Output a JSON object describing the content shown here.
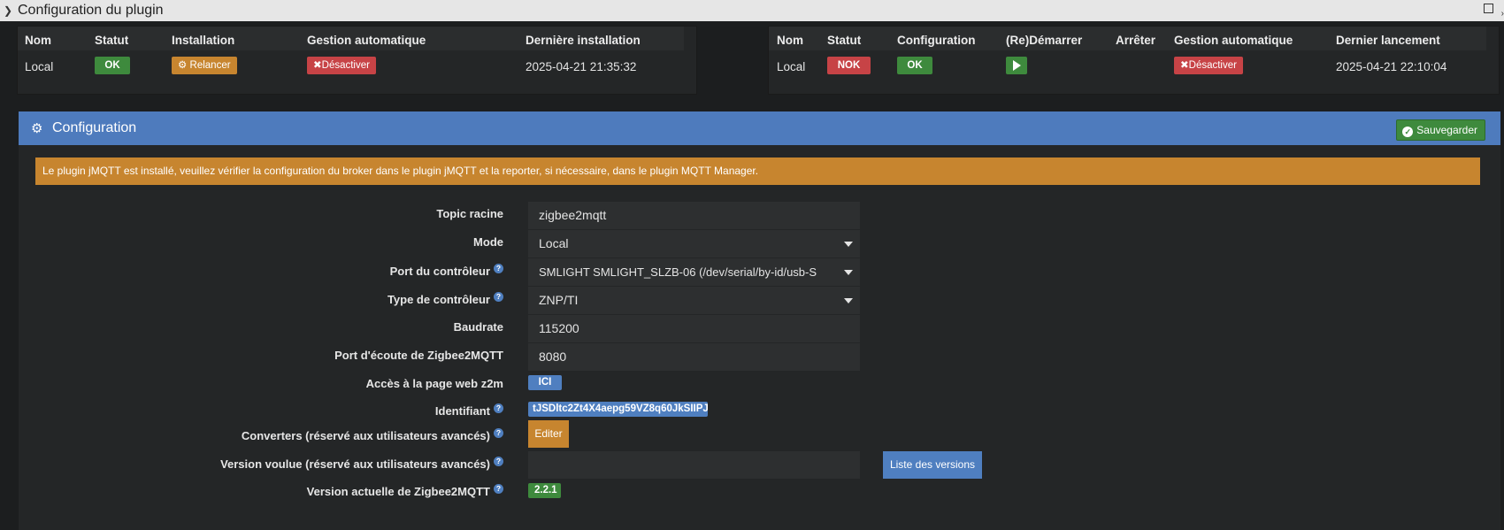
{
  "window": {
    "title": "Configuration du plugin"
  },
  "dependencies": {
    "headers": [
      "Nom",
      "Statut",
      "Installation",
      "Gestion automatique",
      "Dernière installation"
    ],
    "row": {
      "name": "Local",
      "status": "OK",
      "install_button": "Relancer",
      "auto_button": "Désactiver",
      "last_install": "2025-04-21 21:35:32"
    }
  },
  "daemon": {
    "headers": [
      "Nom",
      "Statut",
      "Configuration",
      "(Re)Démarrer",
      "Arrêter",
      "Gestion automatique",
      "Dernier lancement"
    ],
    "row": {
      "name": "Local",
      "status": "NOK",
      "config": "OK",
      "auto_button": "Désactiver",
      "last_launch": "2025-04-21 22:10:04"
    }
  },
  "config": {
    "title": "Configuration",
    "save_label": "Sauvegarder",
    "warning": "Le plugin jMQTT est installé, veuillez vérifier la configuration du broker dans le plugin jMQTT et la reporter, si nécessaire, dans le plugin MQTT Manager.",
    "fields": {
      "topic": {
        "label": "Topic racine",
        "value": "zigbee2mqtt"
      },
      "mode": {
        "label": "Mode",
        "value": "Local"
      },
      "port": {
        "label": "Port du contrôleur",
        "value": "SMLIGHT SMLIGHT_SLZB-06 (/dev/serial/by-id/usb-S"
      },
      "type": {
        "label": "Type de contrôleur",
        "value": "ZNP/TI"
      },
      "baudrate": {
        "label": "Baudrate",
        "value": "115200"
      },
      "listen_port": {
        "label": "Port d'écoute de Zigbee2MQTT",
        "value": "8080"
      },
      "web": {
        "label": "Accès à la page web z2m",
        "value": "ICI"
      },
      "identifier": {
        "label": "Identifiant",
        "value": "tJSDltc2Zt4X4aepg59VZ8q60JkSIIPJ"
      },
      "converters": {
        "label": "Converters (réservé aux utilisateurs avancés)",
        "value": "Editer"
      },
      "version_wanted": {
        "label": "Version voulue (réservé aux utilisateurs avancés)",
        "value": "",
        "button": "Liste des versions"
      },
      "version_current": {
        "label": "Version actuelle de Zigbee2MQTT",
        "value": "2.2.1"
      }
    }
  },
  "colors": {
    "primary": "#4e7bbd",
    "success": "#3e8a3d",
    "warning": "#c7852f",
    "danger": "#c74346",
    "background": "#1c1e1f"
  }
}
